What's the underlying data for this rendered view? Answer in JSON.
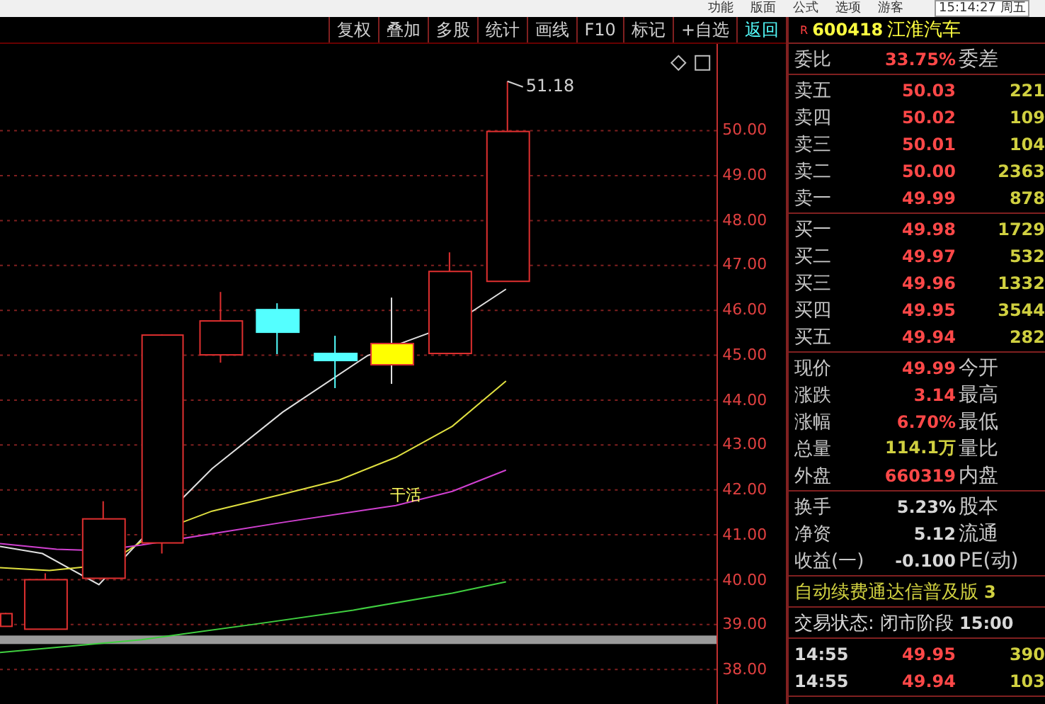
{
  "menu_bar": {
    "items": [
      "功能",
      "版面",
      "公式",
      "选项",
      "游客"
    ],
    "clock": "15:14:27 周五"
  },
  "toolbar": {
    "buttons": [
      {
        "label": "复权",
        "selected": false
      },
      {
        "label": "叠加",
        "selected": false
      },
      {
        "label": "多股",
        "selected": false
      },
      {
        "label": "统计",
        "selected": false
      },
      {
        "label": "画线",
        "selected": false
      },
      {
        "label": "F10",
        "selected": false
      },
      {
        "label": "标记",
        "selected": false
      },
      {
        "label": "+自选",
        "selected": false
      },
      {
        "label": "返回",
        "selected": true
      }
    ]
  },
  "stock_header": {
    "badge": "R",
    "code": "600418",
    "name": "江淮汽车"
  },
  "chart": {
    "high_label": "51.18",
    "ma_label": "干活",
    "y_axis_labels": [
      "50.00",
      "49.00",
      "48.00",
      "47.00",
      "46.00",
      "45.00",
      "44.00",
      "43.00",
      "42.00",
      "41.00",
      "40.00",
      "39.00",
      "38.00"
    ]
  },
  "quote_panel": {
    "sections": [
      [
        {
          "label": "委比",
          "value": "33.75%",
          "extra": "委差",
          "kind": "up"
        }
      ],
      [
        {
          "label": "卖五",
          "value": "50.03",
          "extra": "221",
          "kind": "up"
        },
        {
          "label": "卖四",
          "value": "50.02",
          "extra": "109",
          "kind": "up"
        },
        {
          "label": "卖三",
          "value": "50.01",
          "extra": "104",
          "kind": "up"
        },
        {
          "label": "卖二",
          "value": "50.00",
          "extra": "2363",
          "kind": "up"
        },
        {
          "label": "卖一",
          "value": "49.99",
          "extra": "878",
          "kind": "up"
        }
      ],
      [
        {
          "label": "买一",
          "value": "49.98",
          "extra": "1729",
          "kind": "up"
        },
        {
          "label": "买二",
          "value": "49.97",
          "extra": "532",
          "kind": "up"
        },
        {
          "label": "买三",
          "value": "49.96",
          "extra": "1332",
          "kind": "up"
        },
        {
          "label": "买四",
          "value": "49.95",
          "extra": "3544",
          "kind": "up"
        },
        {
          "label": "买五",
          "value": "49.94",
          "extra": "282",
          "kind": "up"
        }
      ],
      [
        {
          "label": "现价",
          "value": "49.99",
          "extra": "今开",
          "kind": "up"
        },
        {
          "label": "涨跌",
          "value": "3.14",
          "extra": "最高",
          "kind": "up"
        },
        {
          "label": "涨幅",
          "value": "6.70%",
          "extra": "最低",
          "kind": "up"
        },
        {
          "label": "总量",
          "value": "114.1万",
          "extra": "量比",
          "kind": "volume"
        },
        {
          "label": "外盘",
          "value": "660319",
          "extra": "内盘",
          "kind": "up"
        }
      ],
      [
        {
          "label": "换手",
          "value": "5.23%",
          "extra": "股本",
          "kind": "neutral"
        },
        {
          "label": "净资",
          "value": "5.12",
          "extra": "流通",
          "kind": "neutral"
        },
        {
          "label": "收益(一)",
          "value": "-0.100",
          "extra": "PE(动)",
          "kind": "neutral"
        }
      ]
    ],
    "promo": {
      "text": "自动续费通达信普及版",
      "suffix": "3"
    },
    "trade_status": {
      "text": "交易状态: 闭市阶段",
      "time": "15:00"
    },
    "ticks": [
      {
        "time": "14:55",
        "price": "49.95",
        "volume": "390"
      },
      {
        "time": "14:55",
        "price": "49.94",
        "volume": "103"
      }
    ]
  }
}
